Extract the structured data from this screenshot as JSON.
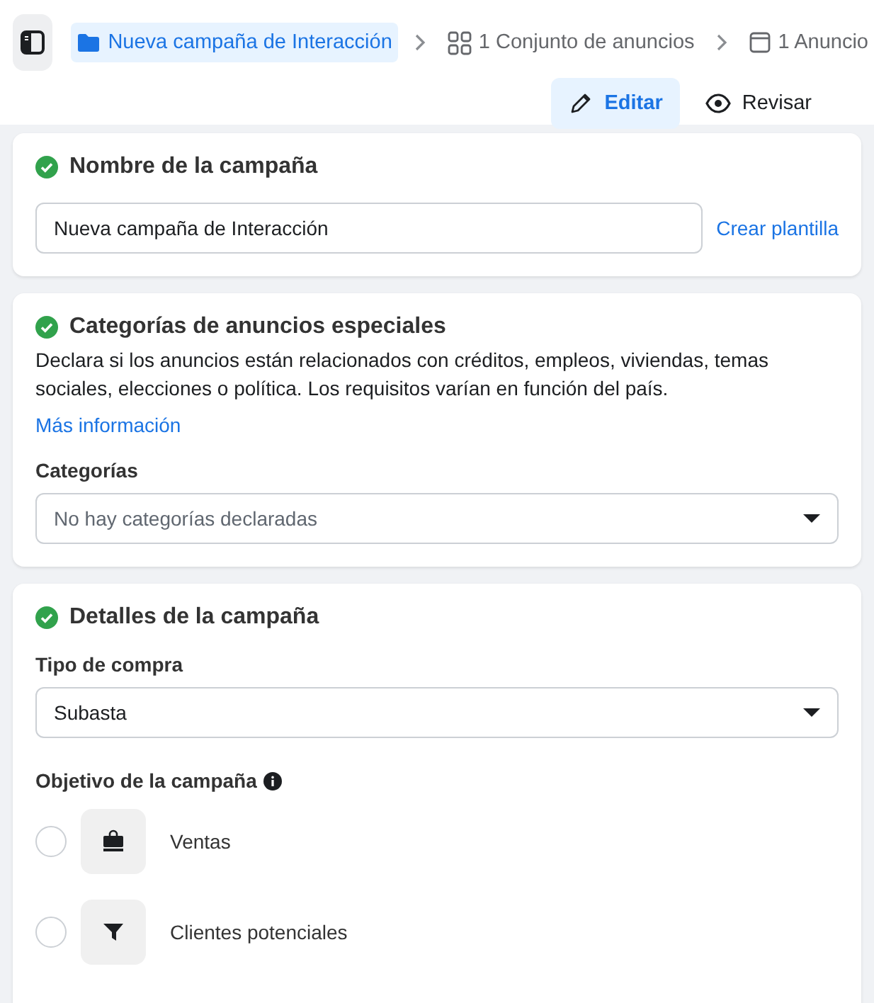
{
  "breadcrumb": [
    {
      "kind": "campaign",
      "label": "Nueva campaña de Interacción",
      "selected": true
    },
    {
      "kind": "adset",
      "label": "1 Conjunto de anuncios",
      "selected": false
    },
    {
      "kind": "ad",
      "label": "1 Anuncio",
      "selected": false
    }
  ],
  "modes": [
    {
      "kind": "edit",
      "label": "Editar",
      "selected": true
    },
    {
      "kind": "review",
      "label": "Revisar",
      "selected": false
    }
  ],
  "name_section": {
    "title": "Nombre de la campaña",
    "complete": true,
    "value": "Nueva campaña de Interacción",
    "link": "Crear plantilla"
  },
  "special_section": {
    "title": "Categorías de anuncios especiales",
    "complete": true,
    "description": "Declara si los anuncios están relacionados con créditos, empleos, viviendas, temas sociales, elecciones o política. Los requisitos varían en función del país.",
    "link": "Más información",
    "field_label": "Categorías",
    "placeholder": "No hay categorías declaradas"
  },
  "details_section": {
    "title": "Detalles de la campaña",
    "complete": true,
    "buy_label": "Tipo de compra",
    "buy_value": "Subasta",
    "objective_label": "Objetivo de la campaña",
    "objectives": [
      {
        "kind": "sales",
        "label": "Ventas",
        "selected": false
      },
      {
        "kind": "leads",
        "label": "Clientes potenciales",
        "selected": false
      }
    ]
  }
}
